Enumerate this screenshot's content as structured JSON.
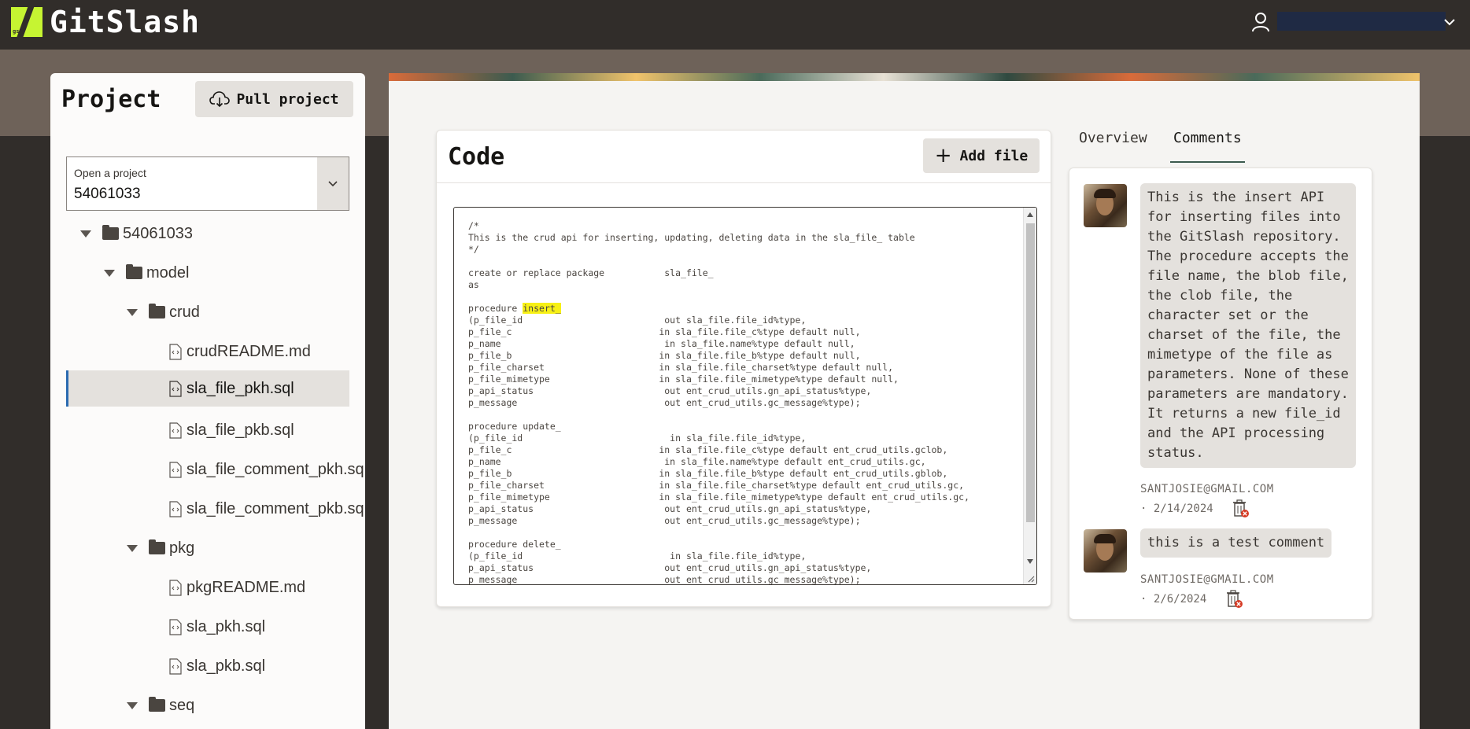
{
  "header": {
    "logo_text": "gs",
    "brand": "GitSlash",
    "user_select_value": ""
  },
  "sidebar": {
    "title": "Project",
    "pull_button": "Pull project",
    "project_select": {
      "label": "Open a project",
      "value": "54061033"
    },
    "tree": [
      {
        "label": "54061033",
        "kind": "folder"
      },
      {
        "label": "model",
        "kind": "folder"
      },
      {
        "label": "crud",
        "kind": "folder"
      },
      {
        "label": "crudREADME.md",
        "kind": "file"
      },
      {
        "label": "sla_file_pkh.sql",
        "kind": "file",
        "selected": true
      },
      {
        "label": "sla_file_pkb.sql",
        "kind": "file"
      },
      {
        "label": "sla_file_comment_pkh.sql",
        "kind": "file"
      },
      {
        "label": "sla_file_comment_pkb.sql",
        "kind": "file"
      },
      {
        "label": "pkg",
        "kind": "folder"
      },
      {
        "label": "pkgREADME.md",
        "kind": "file"
      },
      {
        "label": "sla_pkh.sql",
        "kind": "file"
      },
      {
        "label": "sla_pkb.sql",
        "kind": "file"
      },
      {
        "label": "seq",
        "kind": "folder"
      }
    ]
  },
  "code": {
    "title": "Code",
    "add_button": "Add file",
    "before_highlight": "/*\nThis is the crud api for inserting, updating, deleting data in the sla_file_ table\n*/\n\ncreate or replace package           sla_file_\nas\n\nprocedure ",
    "highlight": "insert_",
    "after_highlight": "\n(p_file_id                          out sla_file.file_id%type,\np_file_c                           in sla_file.file_c%type default null,\np_name                              in sla_file.name%type default null,\np_file_b                           in sla_file.file_b%type default null,\np_file_charset                     in sla_file.file_charset%type default null,\np_file_mimetype                    in sla_file.file_mimetype%type default null,\np_api_status                        out ent_crud_utils.gn_api_status%type,\np_message                           out ent_crud_utils.gc_message%type);\n\nprocedure update_\n(p_file_id                           in sla_file.file_id%type,\np_file_c                           in sla_file.file_c%type default ent_crud_utils.gclob,\np_name                              in sla_file.name%type default ent_crud_utils.gc,\np_file_b                           in sla_file.file_b%type default ent_crud_utils.gblob,\np_file_charset                     in sla_file.file_charset%type default ent_crud_utils.gc,\np_file_mimetype                    in sla_file.file_mimetype%type default ent_crud_utils.gc,\np_api_status                        out ent_crud_utils.gn_api_status%type,\np_message                           out ent_crud_utils.gc_message%type);\n\nprocedure delete_\n(p_file_id                           in sla_file.file_id%type,\np_api_status                        out ent_crud_utils.gn_api_status%type,\np_message                           out ent_crud_utils.gc_message%type);"
  },
  "tabs": {
    "overview": "Overview",
    "comments": "Comments",
    "active": "comments"
  },
  "comments": [
    {
      "text": "This is the insert API for inserting files into the GitSlash repository. The procedure accepts the file name, the blob file, the clob file, the character set or the charset of the file, the mimetype of the file as parameters. None of these parameters are mandatory. It returns a new file_id and the API processing status.",
      "email": "SANTJOSIE@GMAIL.COM",
      "date": "· 2/14/2024"
    },
    {
      "text": "this is a test comment",
      "email": "SANTJOSIE@GMAIL.COM",
      "date": "· 2/6/2024"
    }
  ],
  "colors": {
    "header_bg": "#312d2a",
    "logo_accent": "#c6f432",
    "selection_border": "#2a6ab0",
    "highlight": "#f7f015",
    "delete_badge": "#d63b25"
  }
}
